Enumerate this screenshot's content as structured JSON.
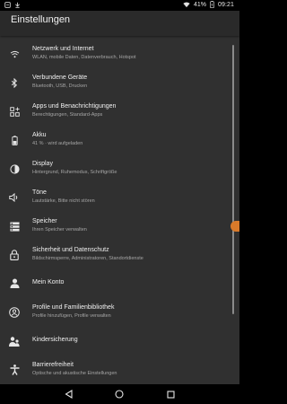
{
  "status_bar": {
    "battery": "41%",
    "time": "09:21"
  },
  "app_bar": {
    "title": "Einstellungen"
  },
  "settings": [
    {
      "icon": "wifi-icon",
      "label": "Netzwerk und Internet",
      "sub": "WLAN, mobile Daten, Datenverbrauch, Hotspot"
    },
    {
      "icon": "bluetooth-icon",
      "label": "Verbundene Geräte",
      "sub": "Bluetooth, USB, Drucken"
    },
    {
      "icon": "apps-icon",
      "label": "Apps und Benachrichtigungen",
      "sub": "Berechtigungen, Standard-Apps"
    },
    {
      "icon": "battery-icon",
      "label": "Akku",
      "sub": "41 % · wird aufgeladen"
    },
    {
      "icon": "display-icon",
      "label": "Display",
      "sub": "Hintergrund, Ruhemodus, Schriftgröße"
    },
    {
      "icon": "volume-icon",
      "label": "Töne",
      "sub": "Lautstärke, Bitte nicht stören"
    },
    {
      "icon": "storage-icon",
      "label": "Speicher",
      "sub": "Ihren Speicher verwalten"
    },
    {
      "icon": "lock-icon",
      "label": "Sicherheit und Datenschutz",
      "sub": "Bildschirmsperre, Administratoren, Standortdienste"
    },
    {
      "icon": "account-icon",
      "label": "Mein Konto",
      "sub": ""
    },
    {
      "icon": "profiles-icon",
      "label": "Profile und Familienbibliothek",
      "sub": "Profile hinzufügen, Profile verwalten"
    },
    {
      "icon": "parental-controls-icon",
      "label": "Kindersicherung",
      "sub": ""
    },
    {
      "icon": "accessibility-icon",
      "label": "Barrierefreiheit",
      "sub": "Optische und akustische Einstellungen"
    }
  ],
  "colors": {
    "background": "#303030",
    "text_primary": "#f0f0f0",
    "text_secondary": "#a6a6a6",
    "edge_handle": "#d97a2a"
  }
}
